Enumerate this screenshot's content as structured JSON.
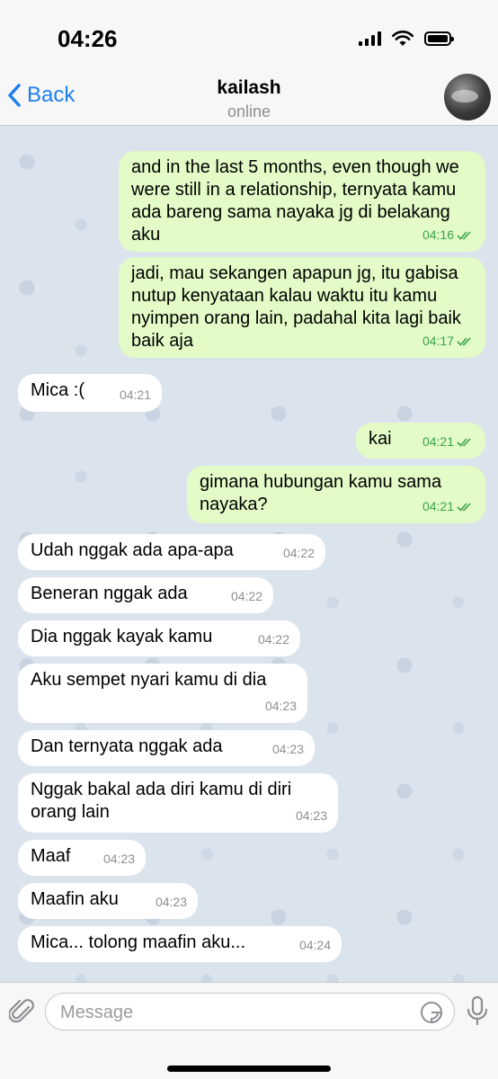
{
  "status_bar": {
    "time": "04:26"
  },
  "header": {
    "back_label": "Back",
    "title": "kailash",
    "status": "online"
  },
  "messages": [
    {
      "dir": "out",
      "text": "and in the last 5 months, even though we were still in a relationship, ternyata kamu ada bareng sama nayaka jg di belakang aku",
      "time": "04:16",
      "read": true
    },
    {
      "dir": "out",
      "text": "jadi, mau sekangen apapun jg, itu gabisa nutup kenyataan kalau waktu itu kamu nyimpen orang lain, padahal kita lagi baik baik aja",
      "time": "04:17",
      "read": true
    },
    {
      "dir": "in",
      "text": "Mica :(",
      "time": "04:21"
    },
    {
      "dir": "out",
      "text": "kai",
      "time": "04:21",
      "read": true
    },
    {
      "dir": "out",
      "text": "gimana hubungan kamu sama nayaka?",
      "time": "04:21",
      "read": true
    },
    {
      "dir": "in",
      "text": "Udah nggak ada apa-apa",
      "time": "04:22"
    },
    {
      "dir": "in",
      "text": "Beneran nggak ada",
      "time": "04:22"
    },
    {
      "dir": "in",
      "text": "Dia nggak kayak kamu",
      "time": "04:22"
    },
    {
      "dir": "in",
      "text": "Aku sempet nyari kamu di dia",
      "time": "04:23"
    },
    {
      "dir": "in",
      "text": "Dan ternyata nggak ada",
      "time": "04:23"
    },
    {
      "dir": "in",
      "text": "Nggak bakal ada diri kamu di diri orang lain",
      "time": "04:23"
    },
    {
      "dir": "in",
      "text": "Maaf",
      "time": "04:23"
    },
    {
      "dir": "in",
      "text": "Maafin aku",
      "time": "04:23"
    },
    {
      "dir": "in",
      "text": "Mica... tolong maafin aku...",
      "time": "04:24"
    }
  ],
  "composer": {
    "placeholder": "Message"
  },
  "icons": [
    "back-chevron-icon",
    "signal-icon",
    "wifi-icon",
    "battery-icon",
    "paperclip-icon",
    "sticker-icon",
    "microphone-icon",
    "double-check-icon"
  ],
  "colors": {
    "accent": "#1e7ff0",
    "outgoing_bubble": "#e2fbc7",
    "incoming_bubble": "#ffffff",
    "read_check": "#3aa34a",
    "chat_background": "#dbe4ec"
  }
}
